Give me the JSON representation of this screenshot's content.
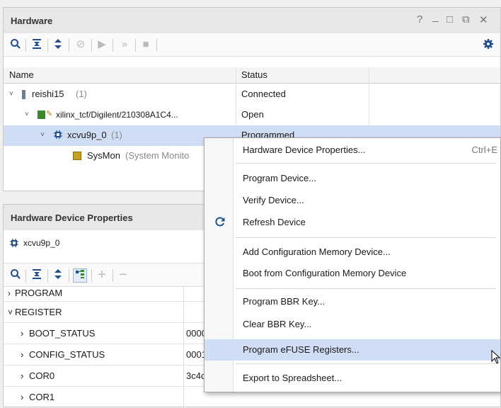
{
  "hardware_panel": {
    "title": "Hardware",
    "window_controls": [
      "?",
      "_",
      "□",
      "⧉",
      "✕"
    ],
    "columns": [
      "Name",
      "Status"
    ],
    "tree": [
      {
        "name": "reishi15",
        "count": "(1)",
        "status": "Connected"
      },
      {
        "name": "xilinx_tcf/Digilent/210308A1C4...",
        "status": "Open"
      },
      {
        "name": "xcvu9p_0",
        "count": "(1)",
        "status": "Programmed"
      },
      {
        "name": "SysMon",
        "suffix": "(System Monito"
      }
    ]
  },
  "properties_panel": {
    "title": "Hardware Device Properties",
    "device": "xcvu9p_0",
    "rows": [
      {
        "name": "PROGRAM",
        "value": "",
        "level": 0,
        "expand": "›"
      },
      {
        "name": "REGISTER",
        "value": "",
        "level": 0,
        "expand": "˅"
      },
      {
        "name": "BOOT_STATUS",
        "value": "0000",
        "level": 1,
        "expand": "›"
      },
      {
        "name": "CONFIG_STATUS",
        "value": "0001",
        "level": 1,
        "expand": "›"
      },
      {
        "name": "COR0",
        "value": "3c4c",
        "level": 1,
        "expand": "›"
      },
      {
        "name": "COR1",
        "value": "",
        "level": 1,
        "expand": "›"
      }
    ]
  },
  "context_menu": {
    "items": [
      {
        "label": "Hardware Device Properties...",
        "shortcut": "Ctrl+E"
      },
      {
        "label": "Program Device..."
      },
      {
        "label": "Verify Device..."
      },
      {
        "label": "Refresh Device",
        "icon": "refresh-icon"
      },
      {
        "label": "Add Configuration Memory Device..."
      },
      {
        "label": "Boot from Configuration Memory Device"
      },
      {
        "label": "Program BBR Key..."
      },
      {
        "label": "Clear BBR Key..."
      },
      {
        "label": "Program eFUSE Registers..."
      },
      {
        "label": "Export to Spreadsheet..."
      }
    ],
    "hovered_index": 8
  },
  "colors": {
    "selection": "#cfddf5",
    "accent": "#1f4e8c",
    "chip": "#3a8a2a"
  }
}
